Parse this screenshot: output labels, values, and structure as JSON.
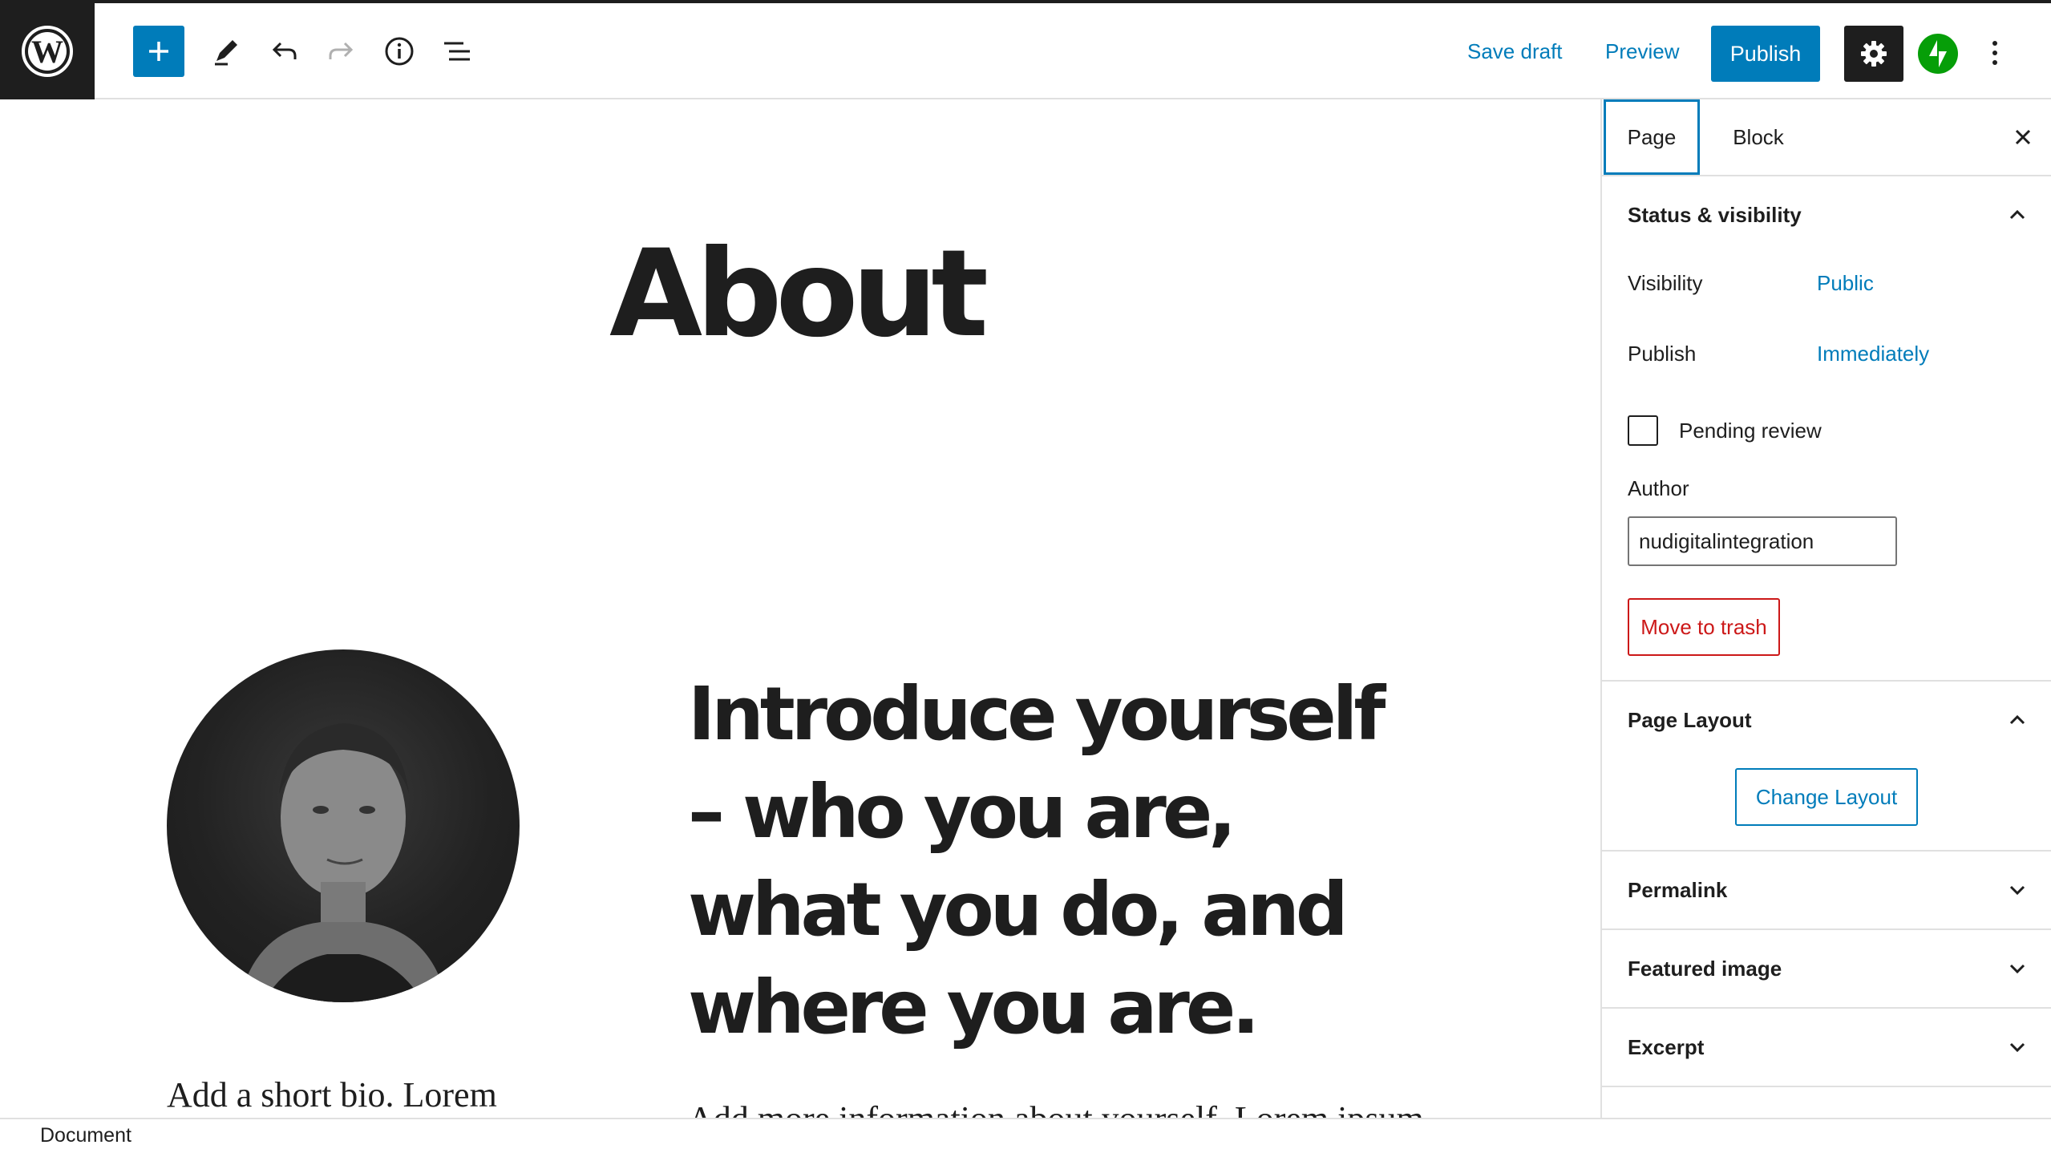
{
  "toolbar": {
    "save_draft": "Save draft",
    "preview": "Preview",
    "publish": "Publish",
    "accent_color": "#007cba",
    "icons": [
      "wordpress-logo",
      "plus-icon",
      "pencil-icon",
      "undo-icon",
      "redo-icon",
      "info-icon",
      "list-view-icon",
      "gear-icon",
      "jetpack-icon",
      "more-vertical-icon"
    ]
  },
  "editor": {
    "title": "About",
    "intro_heading": "Introduce yourself – who you are, what you do, and where you are.",
    "bio": "Add a short bio. Lorem",
    "info": "Add more information about yourself. Lorem ipsum"
  },
  "sidebar": {
    "tabs": [
      {
        "label": "Page",
        "active": true
      },
      {
        "label": "Block",
        "active": false
      }
    ],
    "status_visibility": {
      "title": "Status & visibility",
      "visibility_label": "Visibility",
      "visibility_value": "Public",
      "publish_label": "Publish",
      "publish_value": "Immediately",
      "pending_review_label": "Pending review",
      "pending_review_checked": false,
      "author_label": "Author",
      "author_value": "nudigitalintegration",
      "trash_label": "Move to trash"
    },
    "page_layout": {
      "title": "Page Layout",
      "change_layout": "Change Layout"
    },
    "panels": [
      {
        "title": "Permalink"
      },
      {
        "title": "Featured image"
      },
      {
        "title": "Excerpt"
      }
    ]
  },
  "footer": {
    "breadcrumb": "Document"
  }
}
